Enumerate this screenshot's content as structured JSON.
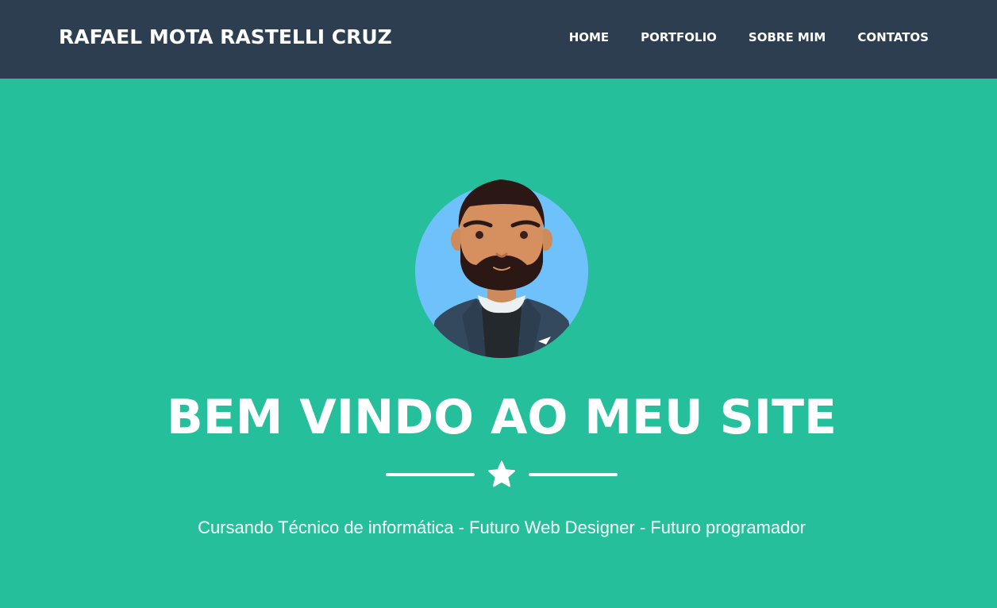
{
  "navbar": {
    "brand": "RAFAEL MOTA RASTELLI CRUZ",
    "items": [
      {
        "label": "HOME"
      },
      {
        "label": "PORTFOLIO"
      },
      {
        "label": "SOBRE MIM"
      },
      {
        "label": "CONTATOS"
      }
    ]
  },
  "masthead": {
    "avatar_icon": "man-avatar-icon",
    "title": "BEM VINDO AO MEU SITE",
    "divider_icon": "star-icon",
    "subtitle": "Cursando Técnico de informática - Futuro Web Designer - Futuro programador"
  },
  "colors": {
    "navbar": "#2c3e50",
    "masthead": "#26bf9c",
    "text": "#ffffff",
    "avatar_bg": "#6ec1fa"
  }
}
